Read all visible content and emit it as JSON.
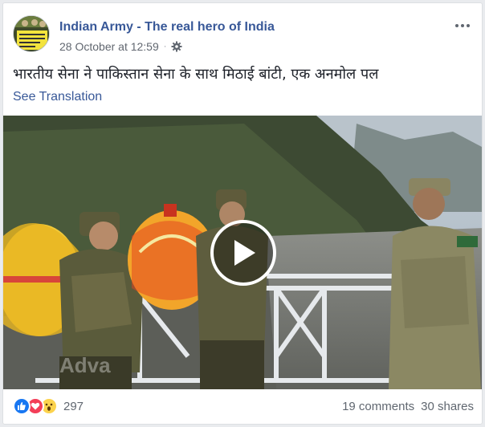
{
  "post": {
    "page_name": "Indian Army - The real hero of India",
    "timestamp": "28 October at 12:59",
    "separator": "·",
    "text": "भारतीय सेना ने पाकिस्तान सेना के साथ मिठाई बांटी, एक अनमोल पल",
    "see_translation": "See Translation"
  },
  "video": {
    "watermark": "Adva"
  },
  "footer": {
    "reactions": [
      "like-icon",
      "love-icon",
      "wow-icon"
    ],
    "reaction_count": "297",
    "comments": "19 comments",
    "shares": "30 shares"
  },
  "colors": {
    "link": "#385898",
    "like": "#1877f2",
    "love": "#f33e58",
    "wow": "#fcd34d",
    "meta": "#616770"
  }
}
